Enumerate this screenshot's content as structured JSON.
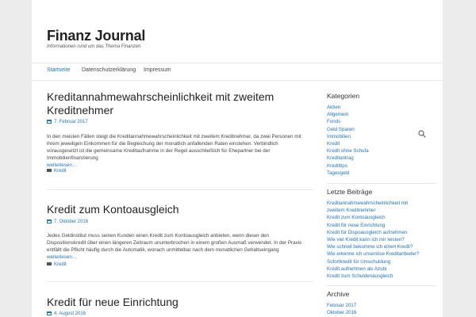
{
  "site": {
    "title": "Finanz Journal",
    "description": "Informationen rund um das Thema Finanzen"
  },
  "nav": {
    "items": [
      "Startseite",
      "Datenschutzerklärung",
      "Impressum"
    ],
    "active": "Startseite",
    "search_icon": "search-icon"
  },
  "posts": [
    {
      "title": "Kreditannahmewahrscheinlichkeit mit zweitem Kreditnehmer",
      "date": "7. Februar 2017",
      "excerpt": "In den meisten Fällen steigt die Kreditannahmewahrscheinlichkeit mit zweitem Kreditnehmer, da zwei Personen mit ihrem jeweiligen Einkommen für die Begleichung der monatlich anfallenden Raten einstehen. Verbindlich vorausgesetzt ist die gemeinsame Kreditaufnahme in der Regel ausschließlich für Ehepartner bei der Immobilienfinanzierung",
      "more": "weiterlesen…",
      "category": "Kredit"
    },
    {
      "title": "Kredit zum Kontoausgleich",
      "date": "7. Oktober 2016",
      "excerpt": "Jedes Geldinstitut muss seinen Kunden einen Kredit zum Kontoausgleich anbieten, wenn dieser den Dispositionskredit über einen längeren Zeitraum ununterbrochen in einem großen Ausmaß verwendet. In der Praxis entfällt die Pflicht häufig durch die Automatik, wonach unmittelbar nach dem monatlichen Gehaltseingang",
      "more": "weiterlesen…",
      "category": "Kredit"
    },
    {
      "title": "Kredit für neue Einrichtung",
      "date": "4. August 2016"
    }
  ],
  "sidebar": {
    "categories": {
      "title": "Kategorien",
      "items": [
        "Aktien",
        "Allgemein",
        "Fonds",
        "Geld Sparen",
        "Immobilien",
        "Kredit",
        "Kredit ohne Schufa",
        "Kreditantrag",
        "Kredittips",
        "Tagesgeld"
      ]
    },
    "recent": {
      "title": "Letzte Beiträge",
      "items": [
        "Kreditannahmewahrscheinlichkeit mit",
        "zweitem Kreditnehmer",
        "Kredit zum Kontoausgleich",
        "Kredit für neue Einrichtung",
        "Kredit für Dispoausgleich aufnehmen",
        "Wie viel Kredit kann ich mir leisten?",
        "Wie schnell bekomme ich einen Kredit?",
        "Wie erkenne ich unseriöse Kreditanbieter?",
        "Sofortkredit für Umschuldung",
        "Kredit aufnehmen als Azubi",
        "Kredit zum Schuldenausgleich"
      ]
    },
    "archive": {
      "title": "Archive",
      "items": [
        "Februar 2017",
        "Oktober 2016"
      ]
    }
  },
  "colors": {
    "link": "#1e73be",
    "text": "#333333",
    "background": "#ececec"
  }
}
